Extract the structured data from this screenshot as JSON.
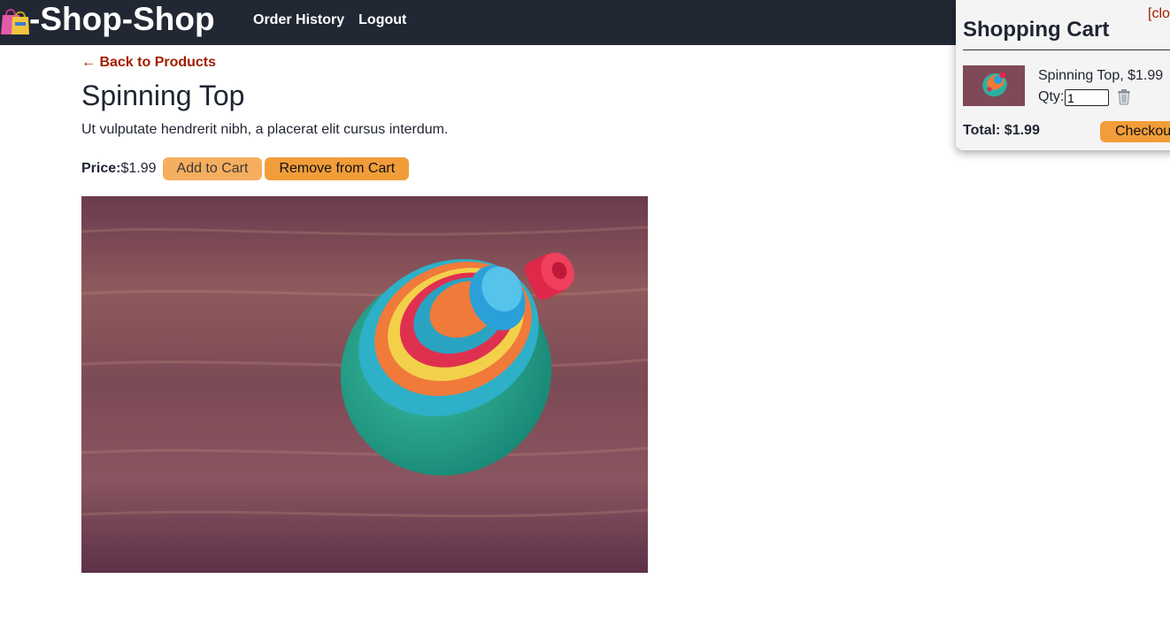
{
  "header": {
    "brand_emoji": "shopping-bags-icon",
    "brand_text": "-Shop-Shop",
    "nav": [
      {
        "label": "Order History"
      },
      {
        "label": "Logout"
      }
    ],
    "background": "#212834"
  },
  "product": {
    "back_link": "← Back to Products",
    "title": "Spinning Top",
    "description": "Ut vulputate hendrerit nibh, a placerat elit cursus interdum.",
    "price_label": "Price:",
    "price_value": "$1.99",
    "add_button": "Add to Cart",
    "remove_button": "Remove from Cart",
    "image_icon": "spinning-top-photo"
  },
  "cart": {
    "close_label": "[close]",
    "title": "Shopping Cart",
    "items": [
      {
        "name": "Spinning Top, $1.99",
        "qty_label": "Qty:",
        "qty_value": "1",
        "delete_icon": "trash-icon"
      }
    ],
    "total": "Total: $1.99",
    "checkout_button": "Checkout"
  },
  "colors": {
    "accent": "#f29d3a",
    "link": "#a31d00"
  }
}
